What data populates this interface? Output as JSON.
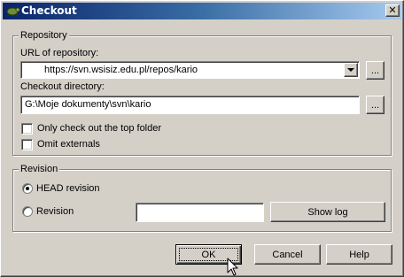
{
  "window": {
    "title": "Checkout",
    "close_glyph": "✕"
  },
  "repository": {
    "group_title": "Repository",
    "url_label": "URL of repository:",
    "url_value": "https://svn.wsisiz.edu.pl/repos/kario",
    "browse_label": "...",
    "dir_label": "Checkout directory:",
    "dir_value": "G:\\Moje dokumenty\\svn\\kario",
    "dir_browse_label": "...",
    "only_top_label": "Only check out the top folder",
    "only_top_checked": false,
    "omit_externals_label": "Omit externals",
    "omit_externals_checked": false
  },
  "revision": {
    "group_title": "Revision",
    "head_label": "HEAD revision",
    "head_selected": true,
    "revision_label": "Revision",
    "revision_value": "",
    "show_log_label": "Show log"
  },
  "buttons": {
    "ok_label": "OK",
    "cancel_label": "Cancel",
    "help_label": "Help"
  },
  "icons": {
    "app": "tortoise-svn-icon",
    "close": "close-icon",
    "dropdown": "chevron-down-icon",
    "cursor": "mouse-pointer-icon"
  },
  "colors": {
    "titlebar_start": "#0a246a",
    "titlebar_end": "#a6caf0",
    "dialog_bg": "#d4d0c8"
  }
}
